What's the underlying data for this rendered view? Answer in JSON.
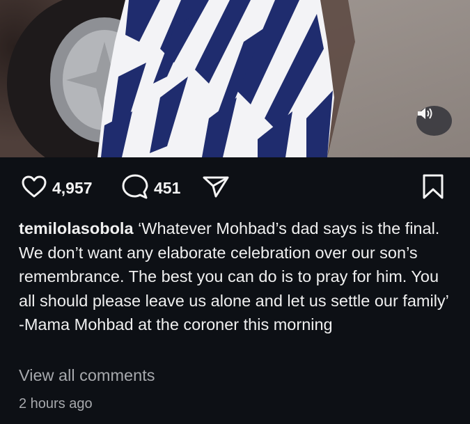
{
  "post": {
    "likes": "4,957",
    "comments": "451",
    "username": "temilolasobola",
    "caption": "‘Whatever Mohbad’s dad says is the final. We don’t want any elaborate celebration over our son’s remembrance. The best you can do is to pray for him. You all should please leave us alone and let us settle our family’ -Mama Mohbad at the coroner this morning",
    "view_all_comments": "View all comments",
    "timestamp": "2 hours ago"
  },
  "icons": {
    "like": "heart-icon",
    "comment": "comment-bubble-icon",
    "share": "send-icon",
    "save": "bookmark-icon",
    "sound": "speaker-icon"
  },
  "colors": {
    "background": "#0d1015",
    "text": "#f2f2f2",
    "muted": "#a7a9ad"
  }
}
